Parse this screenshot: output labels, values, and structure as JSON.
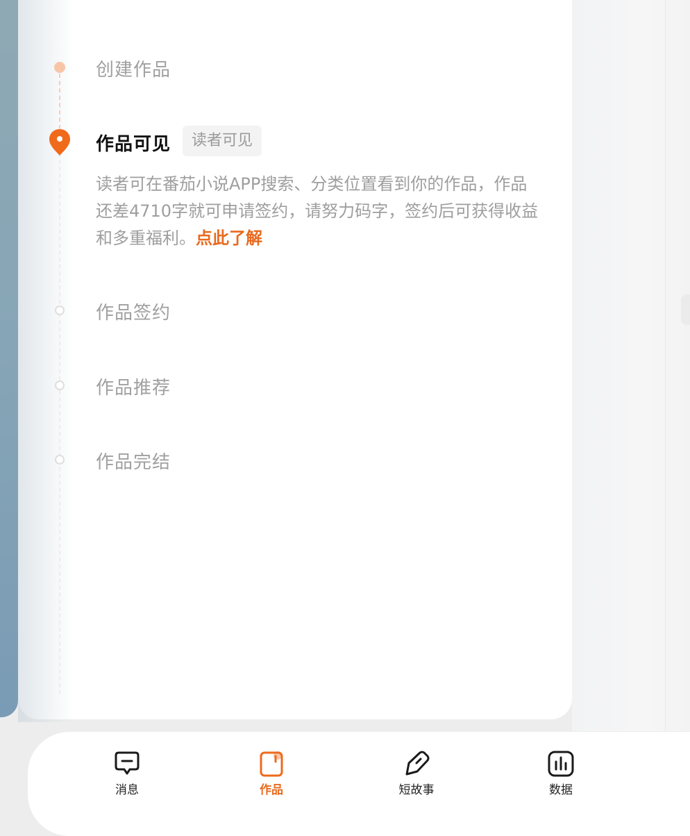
{
  "timeline": {
    "steps": [
      {
        "label": "创建作品",
        "state": "done"
      },
      {
        "label": "作品可见",
        "state": "current"
      },
      {
        "label": "作品签约",
        "state": "pending"
      },
      {
        "label": "作品推荐",
        "state": "pending"
      },
      {
        "label": "作品完结",
        "state": "pending"
      }
    ],
    "current_badge": "读者可见",
    "description": {
      "text": "读者可在番茄小说APP搜索、分类位置看到你的作品，作品还差4710字就可申请签约，请努力码字，签约后可获得收益和多重福利。",
      "link": "点此了解"
    }
  },
  "nav": {
    "items": [
      {
        "label": "消息",
        "icon": "message-icon",
        "active": false
      },
      {
        "label": "作品",
        "icon": "works-icon",
        "active": true
      },
      {
        "label": "短故事",
        "icon": "pen-icon",
        "active": false
      },
      {
        "label": "数据",
        "icon": "chart-icon",
        "active": false
      }
    ]
  },
  "colors": {
    "accent": "#e96a1f",
    "done_dot": "#f8c6a7",
    "muted_text": "#a0a0a0"
  }
}
